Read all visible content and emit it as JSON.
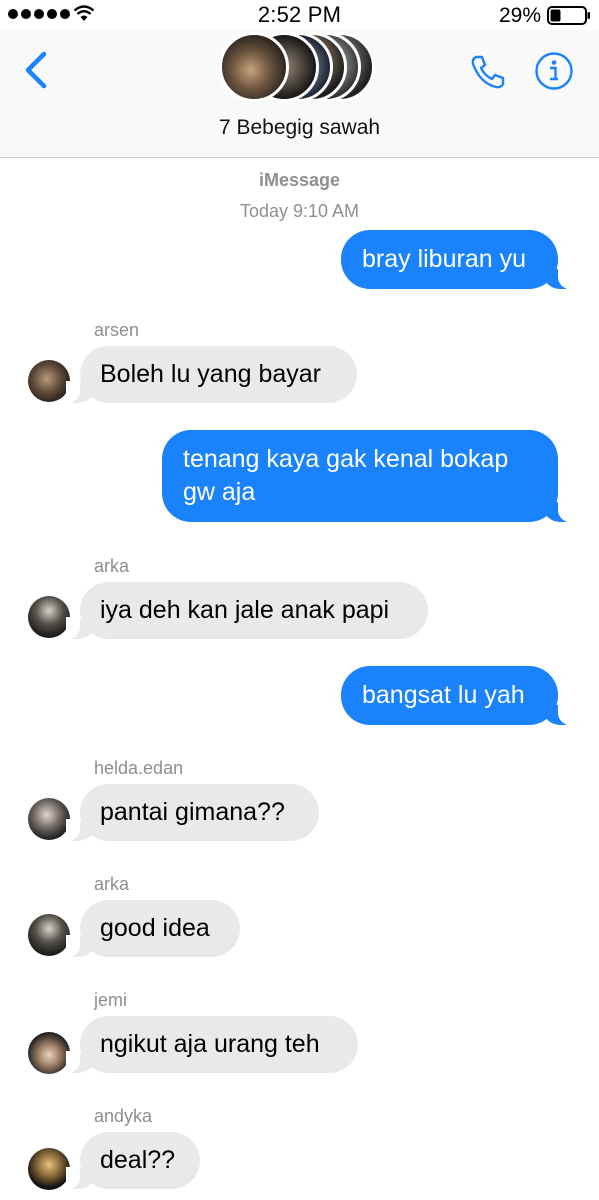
{
  "status_bar": {
    "time": "2:52 PM",
    "battery": "29%"
  },
  "header": {
    "group_name": "7 Bebegig sawah",
    "icons": [
      "back-chevron-icon",
      "phone-icon",
      "info-icon"
    ]
  },
  "chat": {
    "service": "iMessage",
    "timestamp": "Today 9:10 AM",
    "messages": [
      {
        "direction": "out",
        "text": "bray liburan yu"
      },
      {
        "direction": "in",
        "sender": "arsen",
        "text": "Boleh lu yang bayar"
      },
      {
        "direction": "out",
        "text": "tenang kaya gak kenal bokap gw aja"
      },
      {
        "direction": "in",
        "sender": "arka",
        "text": "iya deh kan jale anak papi"
      },
      {
        "direction": "out",
        "text": "bangsat lu yah"
      },
      {
        "direction": "in",
        "sender": "helda.edan",
        "text": "pantai gimana??"
      },
      {
        "direction": "in",
        "sender": "arka",
        "text": "good idea"
      },
      {
        "direction": "in",
        "sender": "jemi",
        "text": "ngikut aja urang teh"
      },
      {
        "direction": "in",
        "sender": "andyka",
        "text": "deal??"
      }
    ]
  },
  "colors": {
    "accent": "#1a82fb",
    "incoming_bubble": "#e9e9eb",
    "meta_text": "#8e8e93"
  }
}
